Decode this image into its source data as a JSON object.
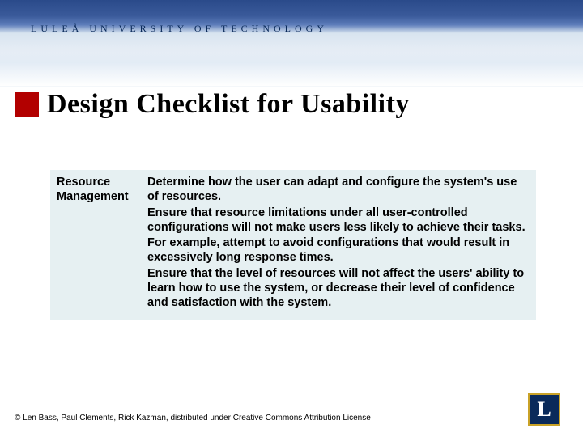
{
  "university": "LULEÅ  UNIVERSITY  OF  TECHNOLOGY",
  "title": "Design Checklist for Usability",
  "table": {
    "left": "Resource Management",
    "right_p1": "Determine how the user can adapt and configure the system's use of resources.",
    "right_p2": "Ensure that resource limitations under all user-controlled configurations will not make users less likely to achieve their tasks.  For example, attempt to avoid configurations that would result in excessively long response times.",
    "right_p3": "Ensure that the level of resources will not affect the users' ability to learn how to use the system, or decrease their level of confidence and satisfaction with the system."
  },
  "footer": "© Len Bass, Paul Clements, Rick Kazman, distributed under Creative Commons Attribution License",
  "logo_letter": "L"
}
